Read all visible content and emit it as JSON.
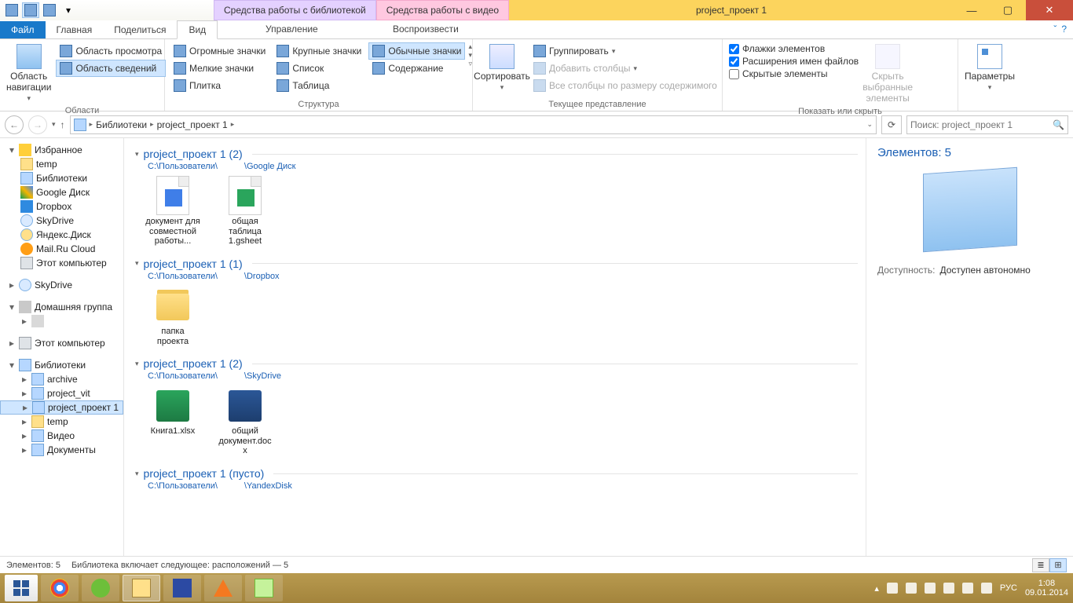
{
  "window": {
    "title": "project_проект 1",
    "context_tabs": [
      "Средства работы с библиотекой",
      "Средства работы с видео"
    ],
    "context_labels": [
      "Управление",
      "Воспроизвести"
    ]
  },
  "tabs": {
    "file": "Файл",
    "home": "Главная",
    "share": "Поделиться",
    "view": "Вид"
  },
  "ribbon": {
    "group_panes": "Области",
    "nav_pane": "Область навигации",
    "preview_pane": "Область просмотра",
    "details_pane": "Область сведений",
    "group_layout": "Структура",
    "huge_icons": "Огромные значки",
    "large_icons": "Крупные значки",
    "medium_icons": "Обычные значки",
    "small_icons": "Мелкие значки",
    "list": "Список",
    "details_view": "Содержание",
    "tiles": "Плитка",
    "table": "Таблица",
    "group_current": "Текущее представление",
    "sort": "Сортировать",
    "group_by": "Группировать",
    "add_columns": "Добавить столбцы",
    "size_all": "Все столбцы по размеру содержимого",
    "group_showhide": "Показать или скрыть",
    "item_checkboxes": "Флажки элементов",
    "file_ext": "Расширения имен файлов",
    "hidden_items": "Скрытые элементы",
    "hide_selected": "Скрыть выбранные элементы",
    "options": "Параметры"
  },
  "breadcrumb": [
    "Библиотеки",
    "project_проект 1"
  ],
  "search_placeholder": "Поиск: project_проект 1",
  "tree": {
    "favorites": "Избранное",
    "fav_items": [
      "temp",
      "Библиотеки",
      "Google Диск",
      "Dropbox",
      "SkyDrive",
      "Яндекс.Диск",
      "Mail.Ru Cloud",
      "Этот компьютер"
    ],
    "skydrive": "SkyDrive",
    "homegroup": "Домашняя группа",
    "this_pc": "Этот компьютер",
    "libraries": "Библиотеки",
    "lib_items": [
      "archive",
      "project_vit",
      "project_проект 1",
      "temp",
      "Видео",
      "Документы"
    ]
  },
  "groups": [
    {
      "title": "project_проект 1 (2)",
      "path1": "C:\\Пользователи\\",
      "path2": "\\Google Диск",
      "items": [
        {
          "name": "документ для совместной работы...",
          "type": "gdoc"
        },
        {
          "name": "общая таблица 1.gsheet",
          "type": "gsheet"
        }
      ]
    },
    {
      "title": "project_проект 1 (1)",
      "path1": "C:\\Пользователи\\",
      "path2": "\\Dropbox",
      "items": [
        {
          "name": "папка проекта",
          "type": "folder"
        }
      ]
    },
    {
      "title": "project_проект 1 (2)",
      "path1": "C:\\Пользователи\\",
      "path2": "\\SkyDrive",
      "items": [
        {
          "name": "Книга1.xlsx",
          "type": "xlsx"
        },
        {
          "name": "общий документ.docx",
          "type": "docx"
        }
      ]
    },
    {
      "title": "project_проект 1 (пусто)",
      "path1": "C:\\Пользователи\\",
      "path2": "\\YandexDisk",
      "items": []
    }
  ],
  "details": {
    "heading": "Элементов: 5",
    "avail_k": "Доступность:",
    "avail_v": "Доступен автономно"
  },
  "status": {
    "count": "Элементов: 5",
    "lib": "Библиотека включает следующее: расположений — 5"
  },
  "tray": {
    "lang": "РУС",
    "time": "1:08",
    "date": "09.01.2014"
  }
}
